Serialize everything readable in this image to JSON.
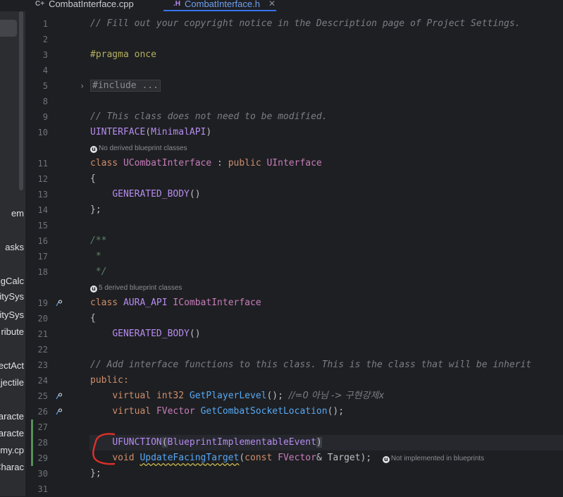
{
  "tabs": [
    {
      "label": "CombatInterface.cpp",
      "icon": "C+",
      "active": false
    },
    {
      "label": "CombatInterface.h",
      "icon": ".H",
      "active": true
    }
  ],
  "left_panel_items": [
    "em",
    "asks",
    "gCalc",
    "litySys",
    "litySys",
    "ribute",
    "ectAct",
    "jectile",
    "aracte",
    "aracte",
    "emy.cp",
    "Charac"
  ],
  "hints": {
    "no_derived": "No derived blueprint classes",
    "five_derived": "5 derived blueprint classes",
    "not_implemented": "Not implemented in blueprints"
  },
  "lines": [
    {
      "n": "1",
      "text": "// Fill out your copyright notice in the Description page of Project Settings."
    },
    {
      "n": "2",
      "text": ""
    },
    {
      "n": "3",
      "text": "#pragma once"
    },
    {
      "n": "4",
      "text": ""
    },
    {
      "n": "5",
      "text": "#include ..."
    },
    {
      "n": "8",
      "text": ""
    },
    {
      "n": "9",
      "text": "// This class does not need to be modified."
    },
    {
      "n": "10",
      "text": "UINTERFACE(MinimalAPI)"
    },
    {
      "n": "11",
      "text": "class UCombatInterface : public UInterface"
    },
    {
      "n": "12",
      "text": "{"
    },
    {
      "n": "13",
      "text": "    GENERATED_BODY()"
    },
    {
      "n": "14",
      "text": "};"
    },
    {
      "n": "15",
      "text": ""
    },
    {
      "n": "16",
      "text": "/**"
    },
    {
      "n": "17",
      "text": " *"
    },
    {
      "n": "18",
      "text": " */"
    },
    {
      "n": "19",
      "text": "class AURA_API ICombatInterface"
    },
    {
      "n": "20",
      "text": "{"
    },
    {
      "n": "21",
      "text": "    GENERATED_BODY()"
    },
    {
      "n": "22",
      "text": ""
    },
    {
      "n": "23",
      "text": "    // Add interface functions to this class. This is the class that will be inherit"
    },
    {
      "n": "24",
      "text": "public:"
    },
    {
      "n": "25",
      "text": "    virtual int32 GetPlayerLevel(); //=0 아님 -> 구현강제x"
    },
    {
      "n": "26",
      "text": "    virtual FVector GetCombatSocketLocation();"
    },
    {
      "n": "27",
      "text": ""
    },
    {
      "n": "28",
      "text": "    UFUNCTION(BlueprintImplementableEvent)"
    },
    {
      "n": "29",
      "text": "    void UpdateFacingTarget(const FVector& Target);"
    },
    {
      "n": "30",
      "text": "};"
    },
    {
      "n": "31",
      "text": ""
    }
  ],
  "tokens": {
    "l1": "// Fill out your copyright notice in the Description page of Project Settings.",
    "pragma_kw": "#pragma",
    "pragma_val": " once",
    "include": "#include ...",
    "l9": "// This class does not need to be modified.",
    "uinterface": "UINTERFACE",
    "minimalapi": "MinimalAPI",
    "class_kw": "class",
    "ucombat": "UCombatInterface",
    "colon": " : ",
    "public_kw": "public",
    "uinterface_type": "UInterface",
    "lbrace": "{",
    "gen_body": "GENERATED_BODY",
    "parens": "()",
    "rbrace_semi": "};",
    "doc_open": "/**",
    "doc_mid": " *",
    "doc_close": " */",
    "aura_api": "AURA_API",
    "icombat": "ICombatInterface",
    "l23": "// Add interface functions to this class. This is the class that will be inherit",
    "public_label": "public:",
    "virtual_kw": "virtual",
    "int32": "int32",
    "getplayerlevel": "GetPlayerLevel",
    "call_semi": "();",
    "korean_comment": "//=0 아님 -> 구현강제x",
    "fvector": "FVector",
    "getsocket": "GetCombatSocketLocation",
    "ufunction": "UFUNCTION",
    "bpimpl": "BlueprintImplementableEvent",
    "void_kw": "void",
    "updatefacing": "UpdateFacingTarget",
    "const_kw": "const",
    "target_param": "& Target);"
  },
  "colors": {
    "background": "#1e1f22",
    "comment": "#7a7e85",
    "keyword": "#cf8e6d",
    "function": "#56a8f5",
    "macro": "#b68cf0",
    "annotation_red": "#e0302a"
  }
}
